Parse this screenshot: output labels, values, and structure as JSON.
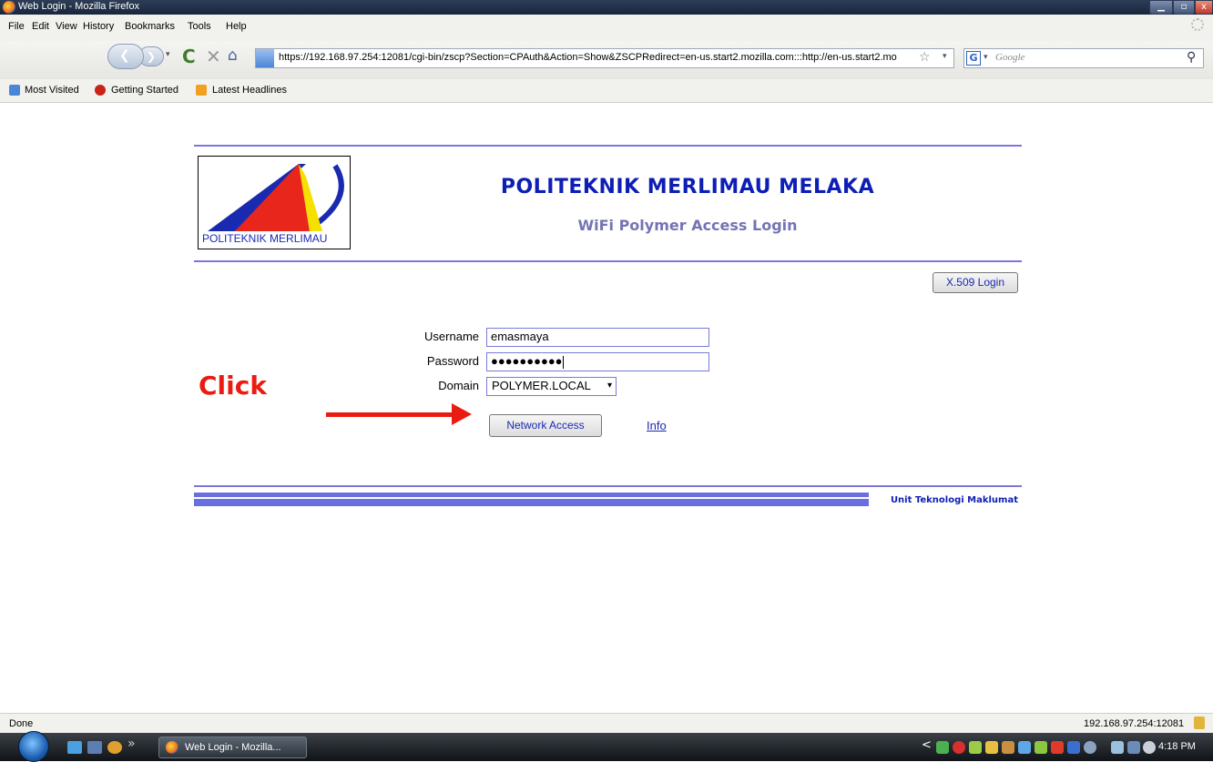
{
  "window": {
    "title": "Web Login - Mozilla Firefox",
    "min_glyph": "▁",
    "max_glyph": "▫",
    "close_glyph": "x"
  },
  "menu": [
    "File",
    "Edit",
    "View",
    "History",
    "Bookmarks",
    "Tools",
    "Help"
  ],
  "nav": {
    "back_glyph": "❮",
    "forward_glyph": "❯",
    "dropdown_glyph": "▾",
    "reload_glyph": "C",
    "stop_glyph": "✕",
    "home_glyph": "⌂",
    "url": "https://192.168.97.254:12081/cgi-bin/zscp?Section=CPAuth&Action=Show&ZSCPRedirect=en-us.start2.mozilla.com:::http://en-us.start2.mo",
    "star_glyph": "☆",
    "search_engine_glyph": "G",
    "search_placeholder": "Google",
    "search_glyph": "⚲"
  },
  "bookmarks": [
    "Most Visited",
    "Getting Started",
    "Latest Headlines"
  ],
  "page": {
    "logo_text": "POLITEKNIK MERLIMAU",
    "org_name": "POLITEKNIK MERLIMAU MELAKA",
    "portal_title": "WiFi Polymer Access Login",
    "x509_button": "X.509 Login",
    "username_label": "Username",
    "username_value": "emasmaya",
    "password_label": "Password",
    "password_value": "●●●●●●●●●●",
    "domain_label": "Domain",
    "domain_value": "POLYMER.LOCAL",
    "domain_arrow": "▾",
    "network_access_button": "Network Access",
    "info_link": "Info",
    "footer_text": "Unit Teknologi Maklumat"
  },
  "annotation": {
    "click_text": "Click",
    "color": "#ea1c12"
  },
  "statusbar": {
    "status": "Done",
    "host": "192.168.97.254:12081"
  },
  "taskbar": {
    "more_glyph": "»",
    "task_label": "Web Login - Mozilla...",
    "tray_expand": "<",
    "clock": "4:18 PM"
  },
  "colors": {
    "accent_blue": "#0d1eb5",
    "subtitle": "#7474b4",
    "rule": "#7c76dc"
  }
}
